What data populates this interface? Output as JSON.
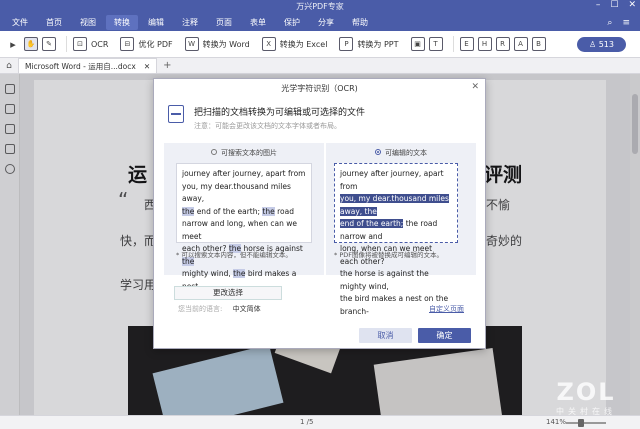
{
  "window": {
    "title": "万兴PDF专家"
  },
  "menu": {
    "items": [
      "文件",
      "首页",
      "视图",
      "转换",
      "编辑",
      "注释",
      "页面",
      "表单",
      "保护",
      "分享",
      "帮助"
    ],
    "active_index": 3
  },
  "toolbar": {
    "ocr": "OCR",
    "optimize": "优化 PDF",
    "to_word": "转换为 Word",
    "to_excel": "转换为 Excel",
    "to_ppt": "转换为 PPT",
    "user_count": "513"
  },
  "doc_tab": {
    "title": "Microsoft Word - 运用自...docx"
  },
  "page_text": {
    "heading_left": "运",
    "heading_right": "评测",
    "quote": "“",
    "line1_left": "西",
    "line1_right": "不愉",
    "line2_left": "快，而",
    "line2_right": "奇妙的",
    "line3_left": "学习用"
  },
  "dialog": {
    "title": "光学字符识别（OCR)",
    "headline": "把扫描的文档转换为可编辑或可选择的文件",
    "subline": "注意：可能会更改该文档的文本字体或者布局。",
    "left_panel_title": "可搜索文本的图片",
    "right_panel_title": "可编辑的文本",
    "left_lines": [
      [
        {
          "t": "journey after journey, apart from",
          "c": ""
        }
      ],
      [
        {
          "t": "you, my dear.thousand miles away,",
          "c": ""
        }
      ],
      [
        {
          "t": "the",
          "c": "hl"
        },
        {
          "t": " end of the earth; ",
          "c": ""
        },
        {
          "t": "the",
          "c": "hl"
        },
        {
          "t": " road",
          "c": ""
        }
      ],
      [
        {
          "t": "narrow and long, when can we meet",
          "c": ""
        }
      ],
      [
        {
          "t": "each other? ",
          "c": ""
        },
        {
          "t": "the",
          "c": "hl"
        },
        {
          "t": " horse is against ",
          "c": ""
        },
        {
          "t": "the",
          "c": "hl"
        }
      ],
      [
        {
          "t": "mighty wind, ",
          "c": ""
        },
        {
          "t": "the",
          "c": "hl"
        },
        {
          "t": " bird makes a nest",
          "c": ""
        }
      ]
    ],
    "right_lines": [
      [
        {
          "t": "journey after journey, apart from",
          "c": ""
        }
      ],
      [
        {
          "t": "you, my dear.thousand miles away, the",
          "c": "sel"
        }
      ],
      [
        {
          "t": "end of the earth;",
          "c": "sel"
        },
        {
          "t": " the road narrow and",
          "c": ""
        }
      ],
      [
        {
          "t": "long, when can we meet each other?",
          "c": ""
        }
      ],
      [
        {
          "t": "the horse is against the mighty wind,",
          "c": ""
        }
      ],
      [
        {
          "t": "the bird makes a nest on the branch-",
          "c": ""
        }
      ]
    ],
    "left_note": "* 可以搜索文本内容，但不能编辑文本。",
    "right_note": "* PDF图像将被替换成可编辑的文本。",
    "change_button": "更改选择",
    "lang_label": "您当前的语言:",
    "lang_value": "中文简体",
    "custom_link": "自定义页面",
    "cancel": "取消",
    "ok": "确定"
  },
  "status": {
    "page": "1 /5",
    "zoom": "141%"
  },
  "watermark": {
    "big": "ZOL",
    "small": "中关村在线"
  },
  "colors": {
    "brand": "#4a5ca8"
  }
}
